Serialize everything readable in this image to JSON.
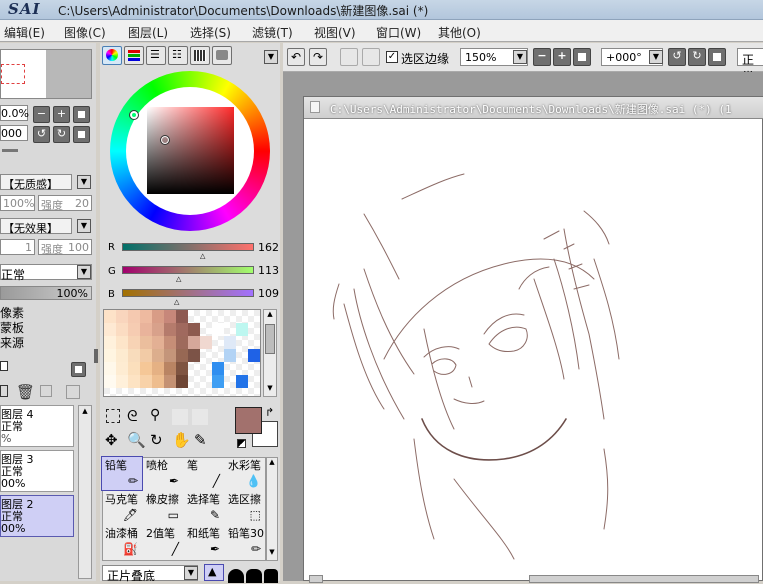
{
  "app": {
    "logo": "SAI",
    "title": "C:\\Users\\Administrator\\Documents\\Downloads\\新建图像.sai (*)"
  },
  "menu": [
    "编辑(E)",
    "图像(C)",
    "图层(L)",
    "选择(S)",
    "滤镜(T)",
    "视图(V)",
    "窗口(W)",
    "其他(O)"
  ],
  "toolbar": {
    "selection_edge_label": "选区边缘",
    "selection_edge_checked": true,
    "zoom": "150%",
    "rotation": "+000°",
    "blend_mode": "正常"
  },
  "nav": {
    "zoom": "0.0%",
    "angle": "000"
  },
  "texture": {
    "name": "【无质感】",
    "opacity": "100%",
    "strength_label": "强度",
    "strength": "20"
  },
  "effect": {
    "name": "【无效果】",
    "width": "1",
    "strength_label": "强度",
    "strength": "100"
  },
  "layer_mode": "正常",
  "layer_opacity": "100%",
  "options": [
    "像素",
    "蒙板",
    "来源"
  ],
  "layers": [
    {
      "name": "图层 4",
      "mode": "正常",
      "opacity": "%",
      "selected": false
    },
    {
      "name": "图层 3",
      "mode": "正常",
      "opacity": "00%",
      "selected": false
    },
    {
      "name": "图层 2",
      "mode": "正常",
      "opacity": "00%",
      "selected": true
    }
  ],
  "rgb": {
    "r_label": "R",
    "r": "162",
    "g_label": "G",
    "g": "113",
    "b_label": "B",
    "b": "109"
  },
  "colors": {
    "current": "#a2716d",
    "accent_selected": "#cfcff5"
  },
  "tools": [
    {
      "name": "铅笔",
      "selected": true
    },
    {
      "name": "喷枪"
    },
    {
      "name": "笔"
    },
    {
      "name": "水彩笔"
    },
    {
      "name": "马克笔"
    },
    {
      "name": "橡皮擦"
    },
    {
      "name": "选择笔"
    },
    {
      "name": "选区擦"
    },
    {
      "name": "油漆桶"
    },
    {
      "name": "2值笔"
    },
    {
      "name": "和纸笔"
    },
    {
      "name": "铅笔30"
    }
  ],
  "brush_blend": "正片叠底",
  "document": {
    "title": "C:\\Users\\Administrator\\Documents\\Downloads\\新建图像.sai (*) (1"
  }
}
